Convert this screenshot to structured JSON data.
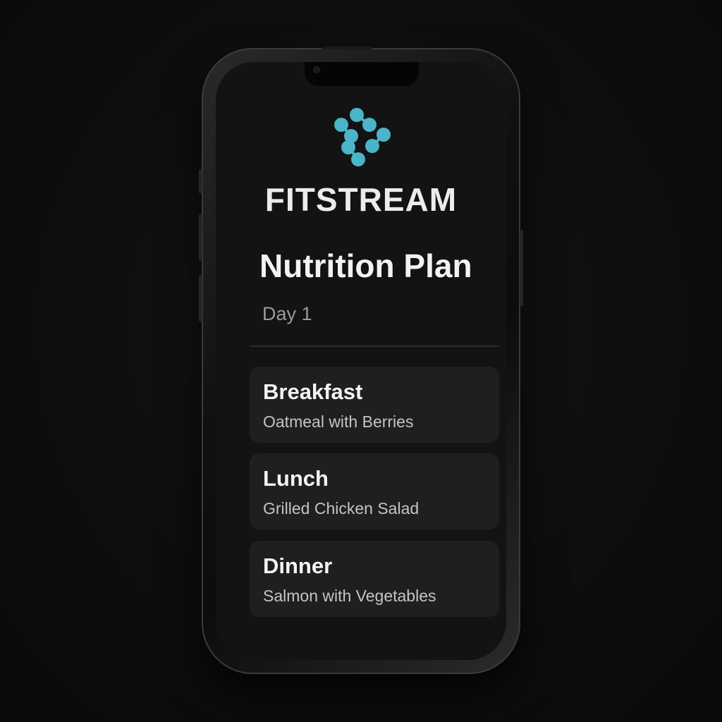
{
  "app": {
    "brand_name": "FITSTREAM",
    "logo_icon": "dumbbell-diamond-icon",
    "accent_color": "#4ab5c8"
  },
  "screen": {
    "title": "Nutrition Plan",
    "subtitle": "Day 1"
  },
  "meals": [
    {
      "name": "Breakfast",
      "description": "Oatmeal with Berries"
    },
    {
      "name": "Lunch",
      "description": "Grilled Chicken Salad"
    },
    {
      "name": "Dinner",
      "description": "Salmon with Vegetables"
    }
  ]
}
